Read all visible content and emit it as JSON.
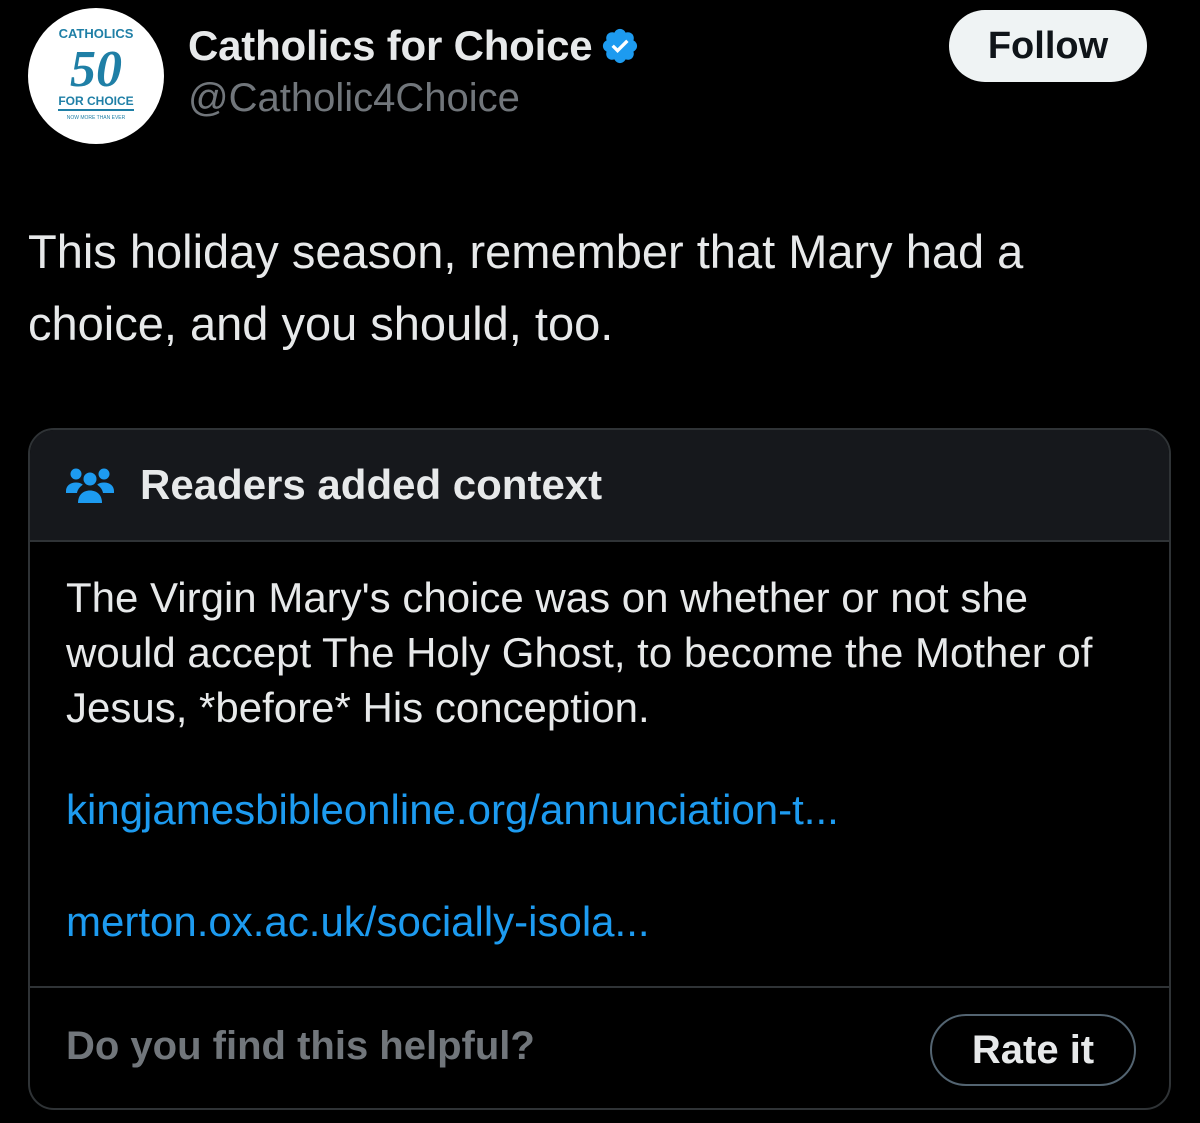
{
  "header": {
    "display_name": "Catholics for Choice",
    "handle": "@Catholic4Choice",
    "follow_label": "Follow",
    "verified_icon": "verified-badge-icon",
    "accent_color": "#1d9bf0"
  },
  "avatar": {
    "logo_top": "CATHOLICS",
    "logo_number": "50",
    "logo_bottom": "FOR CHOICE",
    "logo_tagline": "NOW MORE THAN EVER",
    "logo_color": "#1f7fa6"
  },
  "tweet": {
    "text": "This holiday season, remember that Mary had a choice, and you should, too."
  },
  "note": {
    "title": "Readers added context",
    "icon": "people-icon",
    "body": "The Virgin Mary's choice was on whether or not she would accept The Holy Ghost, to become the Mother of Jesus, *before* His conception.",
    "links": [
      "kingjamesbibleonline.org/annunciation-t...",
      "merton.ox.ac.uk/socially-isola..."
    ],
    "helpful_question": "Do you find this helpful?",
    "rate_label": "Rate it"
  }
}
